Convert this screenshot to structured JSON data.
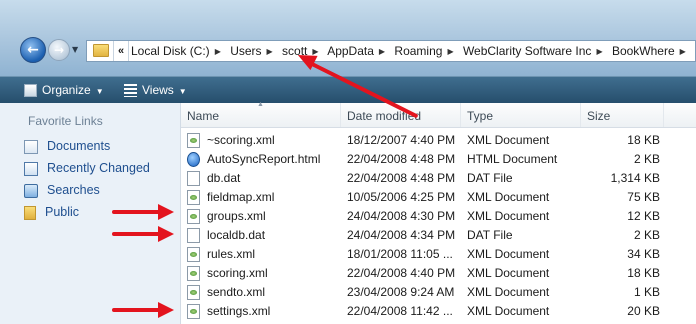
{
  "address": {
    "lead": "«",
    "segments": [
      "Local Disk (C:)",
      "Users",
      "scott",
      "AppData",
      "Roaming",
      "WebClarity Software Inc",
      "BookWhere"
    ]
  },
  "toolbar": {
    "organize_label": "Organize",
    "views_label": "Views"
  },
  "sidebar": {
    "title": "Favorite Links",
    "items": [
      {
        "label": "Documents",
        "icon": "documents-icon"
      },
      {
        "label": "Recently Changed",
        "icon": "recently-changed-icon"
      },
      {
        "label": "Searches",
        "icon": "searches-icon"
      },
      {
        "label": "Public",
        "icon": "public-folder-icon"
      }
    ]
  },
  "columns": {
    "name": "Name",
    "date": "Date modified",
    "type": "Type",
    "size": "Size"
  },
  "files": [
    {
      "name": "~scoring.xml",
      "date": "18/12/2007 4:40 PM",
      "type": "XML Document",
      "size": "18 KB",
      "icon": "xml"
    },
    {
      "name": "AutoSyncReport.html",
      "date": "22/04/2008 4:48 PM",
      "type": "HTML Document",
      "size": "2 KB",
      "icon": "html"
    },
    {
      "name": "db.dat",
      "date": "22/04/2008 4:48 PM",
      "type": "DAT File",
      "size": "1,314 KB",
      "icon": "dat"
    },
    {
      "name": "fieldmap.xml",
      "date": "10/05/2006 4:25 PM",
      "type": "XML Document",
      "size": "75 KB",
      "icon": "xml"
    },
    {
      "name": "groups.xml",
      "date": "24/04/2008 4:30 PM",
      "type": "XML Document",
      "size": "12 KB",
      "icon": "xml"
    },
    {
      "name": "localdb.dat",
      "date": "24/04/2008 4:34 PM",
      "type": "DAT File",
      "size": "2 KB",
      "icon": "dat"
    },
    {
      "name": "rules.xml",
      "date": "18/01/2008 11:05 ...",
      "type": "XML Document",
      "size": "34 KB",
      "icon": "xml"
    },
    {
      "name": "scoring.xml",
      "date": "22/04/2008 4:40 PM",
      "type": "XML Document",
      "size": "18 KB",
      "icon": "xml"
    },
    {
      "name": "sendto.xml",
      "date": "23/04/2008 9:24 AM",
      "type": "XML Document",
      "size": "1 KB",
      "icon": "xml"
    },
    {
      "name": "settings.xml",
      "date": "22/04/2008 11:42 ...",
      "type": "XML Document",
      "size": "20 KB",
      "icon": "xml"
    }
  ],
  "colors": {
    "annotation_arrow": "#e3141e",
    "link": "#1f4f8f",
    "toolbar": "#264e6c"
  }
}
